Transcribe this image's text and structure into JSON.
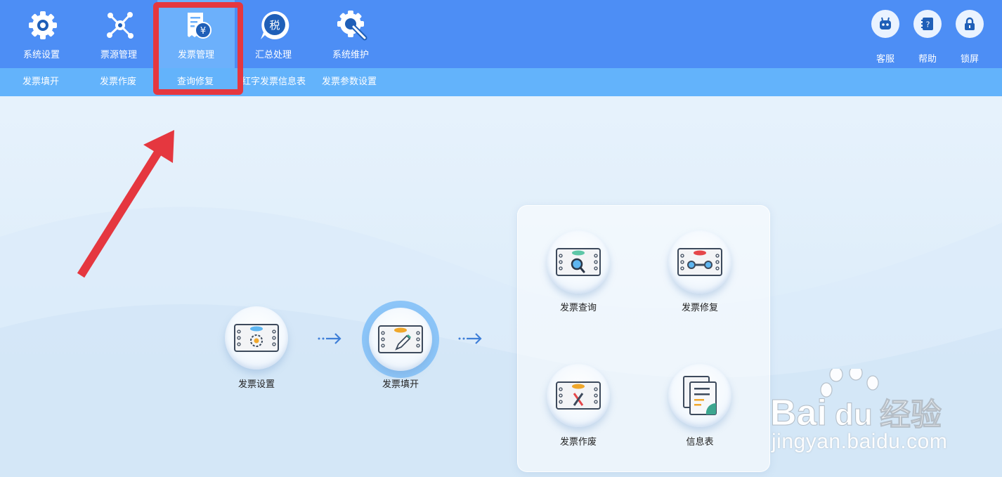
{
  "top_menu": [
    {
      "label": "系统设置",
      "icon": "gear-icon"
    },
    {
      "label": "票源管理",
      "icon": "network-nodes-icon"
    },
    {
      "label": "发票管理",
      "icon": "invoice-yen-icon",
      "active": true
    },
    {
      "label": "汇总处理",
      "icon": "tax-bubble-icon"
    },
    {
      "label": "系统维护",
      "icon": "wrench-gear-icon"
    }
  ],
  "tax_icon_char": "税",
  "right_menu": [
    {
      "label": "客服",
      "icon": "robot-icon"
    },
    {
      "label": "帮助",
      "icon": "help-book-icon"
    },
    {
      "label": "锁屏",
      "icon": "lock-icon"
    }
  ],
  "sub_menu": [
    "发票填开",
    "发票作废",
    "查询修复",
    "红字发票信息表",
    "发票参数设置"
  ],
  "flow": {
    "settings": "发票设置",
    "issue": "发票填开"
  },
  "panel": {
    "query": "发票查询",
    "repair": "发票修复",
    "void": "发票作废",
    "info": "信息表"
  },
  "watermark": {
    "brand": "Bai",
    "brand_tail": "du",
    "cn": "经验",
    "url": "jingyan.baidu.com"
  },
  "colors": {
    "topbar": "#4d8ef5",
    "subbar": "#63b3fb",
    "highlight": "#e5373f",
    "arrow": "#e5373f"
  }
}
